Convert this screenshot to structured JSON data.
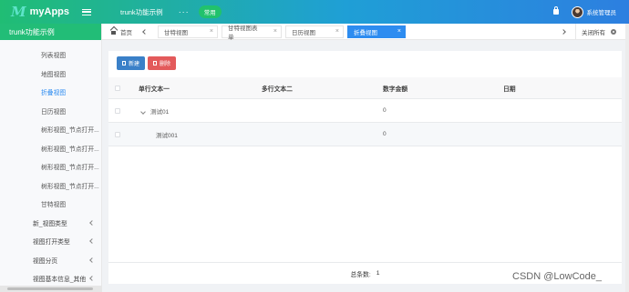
{
  "header": {
    "app_name": "myApps",
    "project": "trunk功能示例",
    "more": "···",
    "tag": "常用",
    "user": "系统管理员"
  },
  "sidebar": {
    "title": "trunk功能示例",
    "sub_items": [
      "列表视图",
      "地图视图",
      "折叠视图",
      "日历视图",
      "树形视图_节点打开...",
      "树形视图_节点打开...",
      "树形视图_节点打开...",
      "树形视图_节点打开...",
      "甘特视图"
    ],
    "active_index": 2,
    "groups": [
      "新_视图类型",
      "视图打开类型",
      "视图分页",
      "视图基本信息_其他"
    ]
  },
  "tabs": {
    "home": "首页",
    "items": [
      {
        "label": "甘特视图",
        "close": "×"
      },
      {
        "label": "甘特视图表单",
        "close": "×"
      },
      {
        "label": "日历视图",
        "close": "×"
      },
      {
        "label": "折叠视图",
        "close": "×",
        "active": true
      }
    ],
    "close_all": "关闭所有"
  },
  "toolbar": {
    "new_label": "新建",
    "delete_label": "删除"
  },
  "table": {
    "columns": [
      "单行文本一",
      "多行文本二",
      "数字金额",
      "日期"
    ],
    "rows": [
      {
        "c1": "测试01",
        "c2": "",
        "c3": "0",
        "c4": "",
        "expandable": true
      },
      {
        "c1": "测试001",
        "c2": "",
        "c3": "0",
        "c4": "",
        "child": true
      }
    ]
  },
  "footer": {
    "total_label": "总条数:",
    "total_value": "1"
  },
  "watermark": "CSDN @LowCode_"
}
